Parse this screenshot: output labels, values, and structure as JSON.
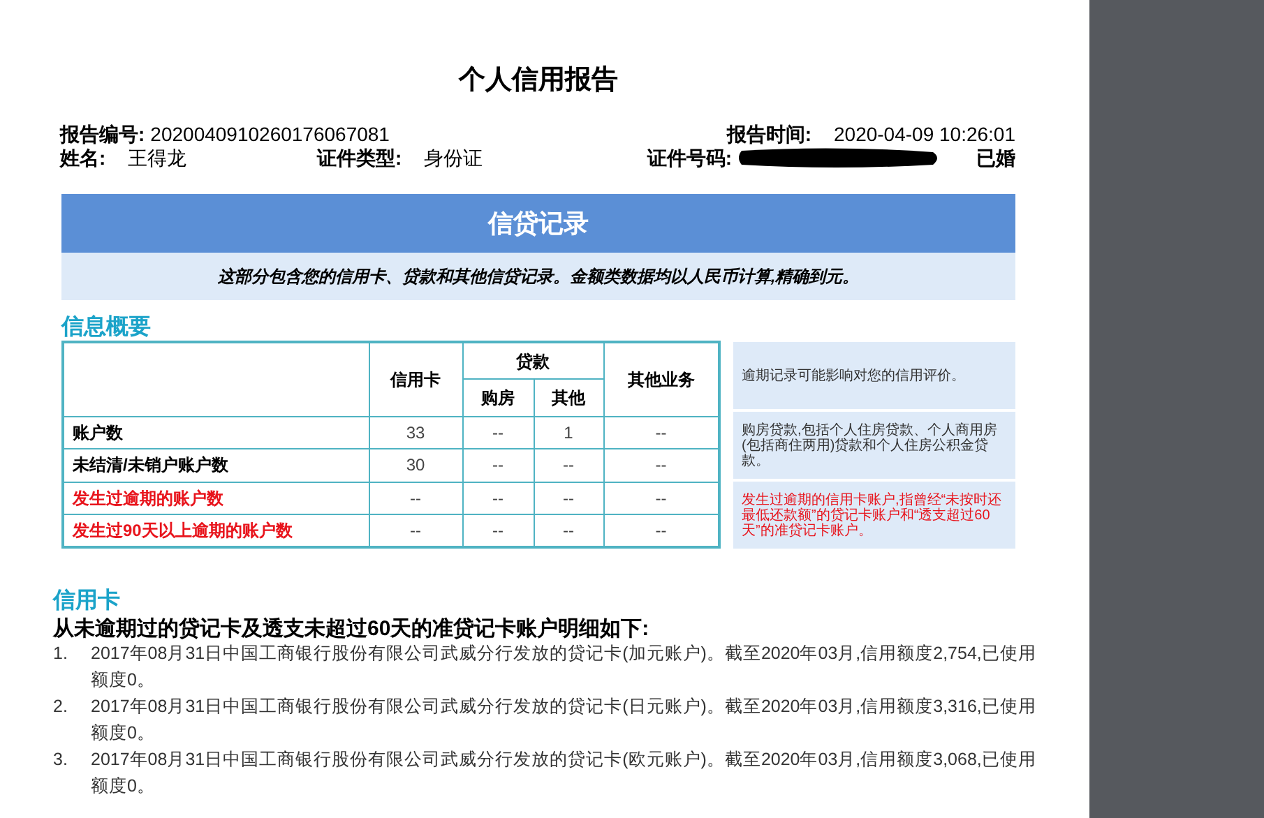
{
  "report": {
    "title": "个人信用报告",
    "header": [
      {
        "label": "报告编号:",
        "value": "2020040910260176067081"
      },
      {
        "label": "报告时间:",
        "value": "2020-04-09 10:26:01"
      },
      {
        "label": "姓名:",
        "value": "王得龙"
      },
      {
        "label": "证件类型:",
        "value": "身份证"
      },
      {
        "label": "证件号码:",
        "value": "已婚",
        "redacted": true
      }
    ],
    "section": {
      "title": "信贷记录",
      "subtitle": "这部分包含您的信用卡、贷款和其他信贷记录。金额类数据均以人民币计算,精确到元。"
    },
    "summary": {
      "heading": "信息概要",
      "columns": {
        "credit_card": "信用卡",
        "loan": "贷款",
        "housing": "购房",
        "other": "其他",
        "other_business": "其他业务"
      },
      "rows": [
        {
          "label": "账户数",
          "alert": false,
          "cells": [
            "33",
            "--",
            "1",
            "--"
          ]
        },
        {
          "label": "未结清/未销户账户数",
          "alert": false,
          "cells": [
            "30",
            "--",
            "--",
            "--"
          ]
        },
        {
          "label": "发生过逾期的账户数",
          "alert": true,
          "cells": [
            "--",
            "--",
            "--",
            "--"
          ]
        },
        {
          "label": "发生过90天以上逾期的账户数",
          "alert": true,
          "cells": [
            "--",
            "--",
            "--",
            "--"
          ]
        }
      ],
      "notes": [
        {
          "text": "逾期记录可能影响对您的信用评价。",
          "alert": false
        },
        {
          "text": "购房贷款,包括个人住房贷款、个人商用房(包括商住两用)贷款和个人住房公积金贷款。",
          "alert": false
        },
        {
          "text": "发生过逾期的信用卡账户,指曾经“未按时还最低还款额”的贷记卡账户和“透支超过60天”的准贷记卡账户。",
          "alert": true
        }
      ]
    },
    "credit_card": {
      "heading": "信用卡",
      "intro": "从未逾期过的贷记卡及透支未超过60天的准贷记卡账户明细如下:",
      "items": [
        {
          "number": "1.",
          "text": "2017年08月31日中国工商银行股份有限公司武威分行发放的贷记卡(加元账户)。截至2020年03月,信用额度2,754,已使用额度0。"
        },
        {
          "number": "2.",
          "text": "2017年08月31日中国工商银行股份有限公司武威分行发放的贷记卡(日元账户)。截至2020年03月,信用额度3,316,已使用额度0。"
        },
        {
          "number": "3.",
          "text": "2017年08月31日中国工商银行股份有限公司武威分行发放的贷记卡(欧元账户)。截至2020年03月,信用额度3,068,已使用额度0。"
        }
      ]
    }
  }
}
